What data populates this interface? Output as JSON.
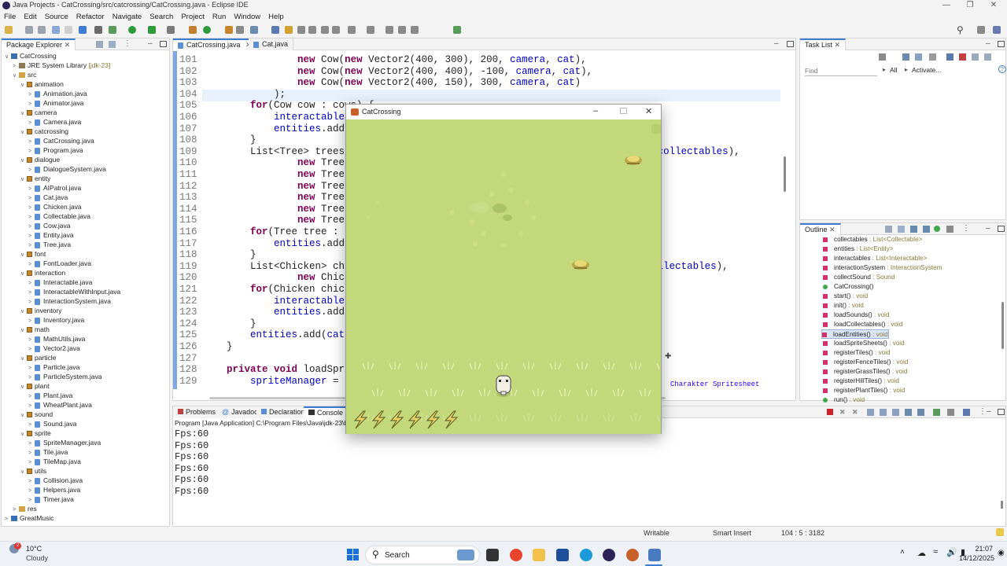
{
  "window": {
    "title": "Java Projects - CatCrossing/src/catcrossing/CatCrossing.java - Eclipse IDE"
  },
  "menu": [
    "File",
    "Edit",
    "Source",
    "Refactor",
    "Navigate",
    "Search",
    "Project",
    "Run",
    "Window",
    "Help"
  ],
  "package_explorer": {
    "tab": "Package Explorer",
    "rows": [
      {
        "label": "CatCrossing",
        "kind": "project",
        "indent": 0,
        "twisty": "v"
      },
      {
        "label": "JRE System Library",
        "suffix": "[jdk-23]",
        "kind": "lib",
        "indent": 1,
        "twisty": ">"
      },
      {
        "label": "src",
        "kind": "folder",
        "indent": 1,
        "twisty": "v"
      },
      {
        "label": "animation",
        "kind": "package",
        "indent": 2,
        "twisty": "v"
      },
      {
        "label": "Animation.java",
        "kind": "file",
        "indent": 3,
        "twisty": ">"
      },
      {
        "label": "Animator.java",
        "kind": "file",
        "indent": 3,
        "twisty": ">"
      },
      {
        "label": "camera",
        "kind": "package",
        "indent": 2,
        "twisty": "v"
      },
      {
        "label": "Camera.java",
        "kind": "file",
        "indent": 3,
        "twisty": ">"
      },
      {
        "label": "catcrossing",
        "kind": "package",
        "indent": 2,
        "twisty": "v"
      },
      {
        "label": "CatCrossing.java",
        "kind": "file",
        "indent": 3,
        "twisty": ">"
      },
      {
        "label": "Program.java",
        "kind": "file",
        "indent": 3,
        "twisty": ">"
      },
      {
        "label": "dialogue",
        "kind": "package",
        "indent": 2,
        "twisty": "v"
      },
      {
        "label": "DialogueSystem.java",
        "kind": "file",
        "indent": 3,
        "twisty": ">"
      },
      {
        "label": "entity",
        "kind": "package",
        "indent": 2,
        "twisty": "v"
      },
      {
        "label": "AIPatrol.java",
        "kind": "file",
        "indent": 3,
        "twisty": ">"
      },
      {
        "label": "Cat.java",
        "kind": "file",
        "indent": 3,
        "twisty": ">"
      },
      {
        "label": "Chicken.java",
        "kind": "file",
        "indent": 3,
        "twisty": ">"
      },
      {
        "label": "Collectable.java",
        "kind": "file",
        "indent": 3,
        "twisty": ">"
      },
      {
        "label": "Cow.java",
        "kind": "file",
        "indent": 3,
        "twisty": ">"
      },
      {
        "label": "Entity.java",
        "kind": "file",
        "indent": 3,
        "twisty": ">"
      },
      {
        "label": "Tree.java",
        "kind": "file",
        "indent": 3,
        "twisty": ">"
      },
      {
        "label": "font",
        "kind": "package",
        "indent": 2,
        "twisty": "v"
      },
      {
        "label": "FontLoader.java",
        "kind": "file",
        "indent": 3,
        "twisty": ">"
      },
      {
        "label": "interaction",
        "kind": "package",
        "indent": 2,
        "twisty": "v"
      },
      {
        "label": "Interactable.java",
        "kind": "file",
        "indent": 3,
        "twisty": ">"
      },
      {
        "label": "InteractableWithInput.java",
        "kind": "file",
        "indent": 3,
        "twisty": ">"
      },
      {
        "label": "InteractionSystem.java",
        "kind": "file",
        "indent": 3,
        "twisty": ">"
      },
      {
        "label": "inventory",
        "kind": "package",
        "indent": 2,
        "twisty": "v"
      },
      {
        "label": "Inventory.java",
        "kind": "file",
        "indent": 3,
        "twisty": ">"
      },
      {
        "label": "math",
        "kind": "package",
        "indent": 2,
        "twisty": "v"
      },
      {
        "label": "MathUtils.java",
        "kind": "file",
        "indent": 3,
        "twisty": ">"
      },
      {
        "label": "Vector2.java",
        "kind": "file",
        "indent": 3,
        "twisty": ">"
      },
      {
        "label": "particle",
        "kind": "package",
        "indent": 2,
        "twisty": "v"
      },
      {
        "label": "Particle.java",
        "kind": "file",
        "indent": 3,
        "twisty": ">"
      },
      {
        "label": "ParticleSystem.java",
        "kind": "file",
        "indent": 3,
        "twisty": ">"
      },
      {
        "label": "plant",
        "kind": "package",
        "indent": 2,
        "twisty": "v"
      },
      {
        "label": "Plant.java",
        "kind": "file",
        "indent": 3,
        "twisty": ">"
      },
      {
        "label": "WheatPlant.java",
        "kind": "file",
        "indent": 3,
        "twisty": ">"
      },
      {
        "label": "sound",
        "kind": "package",
        "indent": 2,
        "twisty": "v"
      },
      {
        "label": "Sound.java",
        "kind": "file",
        "indent": 3,
        "twisty": ">"
      },
      {
        "label": "sprite",
        "kind": "package",
        "indent": 2,
        "twisty": "v"
      },
      {
        "label": "SpriteManager.java",
        "kind": "file",
        "indent": 3,
        "twisty": ">"
      },
      {
        "label": "Tile.java",
        "kind": "file",
        "indent": 3,
        "twisty": ">"
      },
      {
        "label": "TileMap.java",
        "kind": "file",
        "indent": 3,
        "twisty": ">"
      },
      {
        "label": "utils",
        "kind": "package",
        "indent": 2,
        "twisty": "v"
      },
      {
        "label": "Collision.java",
        "kind": "file",
        "indent": 3,
        "twisty": ">"
      },
      {
        "label": "Helpers.java",
        "kind": "file",
        "indent": 3,
        "twisty": ">"
      },
      {
        "label": "Timer.java",
        "kind": "file",
        "indent": 3,
        "twisty": ">"
      },
      {
        "label": "res",
        "kind": "folder",
        "indent": 1,
        "twisty": ">"
      },
      {
        "label": "GreatMusic",
        "kind": "project",
        "indent": 0,
        "twisty": ">"
      }
    ]
  },
  "editor": {
    "tabs": [
      {
        "label": "CatCrossing.java",
        "active": true
      },
      {
        "label": "Cat.java",
        "active": false
      }
    ],
    "lines": [
      {
        "n": "101",
        "html": "                <span class=\"kw\">new</span> Cow(<span class=\"kw\">new</span> Vector2(400, 300), 200, <span class=\"fld\">camera</span>, <span class=\"fld\">cat</span>),"
      },
      {
        "n": "102",
        "html": "                <span class=\"kw\">new</span> Cow(<span class=\"kw\">new</span> Vector2(400, 400), -100, <span class=\"fld\">camera</span>, <span class=\"fld\">cat</span>),"
      },
      {
        "n": "103",
        "html": "                <span class=\"kw\">new</span> Cow(<span class=\"kw\">new</span> Vector2(400, 150), 300, <span class=\"fld\">camera</span>, <span class=\"fld\">cat</span>)"
      },
      {
        "n": "104",
        "html": "            );"
      },
      {
        "n": "105",
        "html": "        <span class=\"kw\">for</span>(Cow cow : cows) {"
      },
      {
        "n": "106",
        "html": "            <span class=\"fld\">interactables</span>.add(cow);"
      },
      {
        "n": "107",
        "html": "            <span class=\"fld\">entities</span>.add(cow);"
      },
      {
        "n": "108",
        "html": "        }"
      },
      {
        "n": "109",
        "html": "        List&lt;Tree&gt; trees = List.of(                                          <span class=\"fld\">collectables</span>),"
      },
      {
        "n": "110",
        "html": "                <span class=\"kw\">new</span> Tree(<span class=\"kw\">new</span>"
      },
      {
        "n": "111",
        "html": "                <span class=\"kw\">new</span> Tree(<span class=\"kw\">new</span>"
      },
      {
        "n": "112",
        "html": "                <span class=\"kw\">new</span> Tree(<span class=\"kw\">new</span>"
      },
      {
        "n": "113",
        "html": "                <span class=\"kw\">new</span> Tree(<span class=\"kw\">new</span>"
      },
      {
        "n": "114",
        "html": "                <span class=\"kw\">new</span> Tree(<span class=\"kw\">new</span>"
      },
      {
        "n": "115",
        "html": "                <span class=\"kw\">new</span> Tree(<span class=\"kw\">new</span>"
      },
      {
        "n": "116",
        "html": "        <span class=\"kw\">for</span>(Tree tree : trees) {"
      },
      {
        "n": "117",
        "html": "            <span class=\"fld\">entities</span>.add(tree);"
      },
      {
        "n": "118",
        "html": "        }"
      },
      {
        "n": "119",
        "html": "        List&lt;Chicken&gt; chickens = List.of(                              nt, <span class=\"fld\">collectables</span>),"
      },
      {
        "n": "120",
        "html": "                <span class=\"kw\">new</span> Chicken("
      },
      {
        "n": "121",
        "html": "        <span class=\"kw\">for</span>(Chicken chicken : chickens) {"
      },
      {
        "n": "122",
        "html": "            <span class=\"fld\">interactables</span>.add(chicken);"
      },
      {
        "n": "123",
        "html": "            <span class=\"fld\">entities</span>.add(chicken);"
      },
      {
        "n": "124",
        "html": "        }"
      },
      {
        "n": "125",
        "html": "        <span class=\"fld\">entities</span>.add(<span class=\"fld\">cat</span>);"
      },
      {
        "n": "126",
        "html": "    }"
      },
      {
        "n": "127",
        "html": ""
      },
      {
        "n": "128",
        "html": "    <span class=\"kw\">private void</span> loadSpriteSheets() {"
      },
      {
        "n": "129",
        "html": "        <span class=\"fld\">spriteManager</span> = <span class=\"kw\">new</span> SpriteManager();"
      }
    ],
    "right_overflow": "Charakter Spritesheet"
  },
  "task_list": {
    "tab": "Task List",
    "find_placeholder": "Find",
    "all_label": "All",
    "activate_label": "Activate..."
  },
  "outline": {
    "tab": "Outline",
    "items": [
      {
        "name": "collectables",
        "type": " : List<Collectable>",
        "kind": "field"
      },
      {
        "name": "entities",
        "type": " : List<Entity>",
        "kind": "field"
      },
      {
        "name": "interactables",
        "type": " : List<Interactable>",
        "kind": "field"
      },
      {
        "name": "interactionSystem",
        "type": " : InteractionSystem",
        "kind": "field"
      },
      {
        "name": "collectSound",
        "type": " : Sound",
        "kind": "field"
      },
      {
        "name": "CatCrossing()",
        "type": "",
        "kind": "method"
      },
      {
        "name": "start()",
        "type": " : void",
        "kind": "field"
      },
      {
        "name": "init()",
        "type": " : void",
        "kind": "field"
      },
      {
        "name": "loadSounds()",
        "type": " : void",
        "kind": "field"
      },
      {
        "name": "loadCollectables()",
        "type": " : void",
        "kind": "field"
      },
      {
        "name": "loadEntities()",
        "type": " : void",
        "kind": "field",
        "selected": true
      },
      {
        "name": "loadSpriteSheets()",
        "type": " : void",
        "kind": "field"
      },
      {
        "name": "registerTiles()",
        "type": " : void",
        "kind": "field"
      },
      {
        "name": "registerFenceTiles()",
        "type": " : void",
        "kind": "field"
      },
      {
        "name": "registerGrassTiles()",
        "type": " : void",
        "kind": "field"
      },
      {
        "name": "registerHillTiles()",
        "type": " : void",
        "kind": "field"
      },
      {
        "name": "registerPlantTiles()",
        "type": " : void",
        "kind": "field"
      },
      {
        "name": "run()",
        "type": " : void",
        "kind": "method"
      }
    ]
  },
  "console": {
    "tabs": [
      "Problems",
      "Javadoc",
      "Declaration",
      "Console"
    ],
    "active_tab": "Console",
    "header": "Program [Java Application] C:\\Program Files\\Java\\jdk-23\\bin\\",
    "lines": [
      "Fps:60",
      "Fps:60",
      "Fps:60",
      "Fps:60",
      "Fps:60",
      "Fps:60"
    ]
  },
  "game": {
    "title": "CatCrossing",
    "lightning_count": 6
  },
  "statusbar": {
    "writable": "Writable",
    "insert_mode": "Smart Insert",
    "position": "104 : 5 : 3182"
  },
  "taskbar": {
    "weather_temp": "10°C",
    "weather_desc": "Cloudy",
    "search_label": "Search",
    "time": "21:07",
    "date": "14/12/2025"
  },
  "colors": {
    "accent": "#3e7bd2",
    "grass": "#c3d87a",
    "keyword": "#7f0055",
    "field": "#0000c0"
  }
}
